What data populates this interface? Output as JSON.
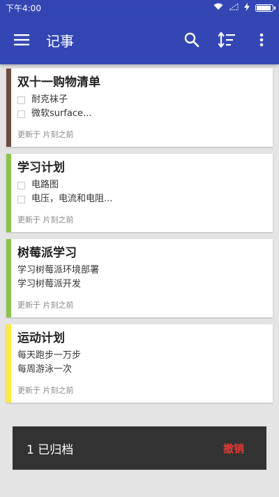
{
  "statusbar": {
    "time": "下午4:00",
    "battery_level": 0.9
  },
  "appbar": {
    "title": "记事"
  },
  "icons": {
    "menu": "hamburger-menu-icon",
    "search": "search-icon",
    "sort": "sort-icon",
    "more": "more-vert-icon"
  },
  "notes": [
    {
      "title": "双十一购物清单",
      "color": "#6d4c41",
      "lines": [
        "耐克袜子",
        "微软surface..."
      ],
      "updated": "更新于 片刻之前"
    },
    {
      "title": "学习计划",
      "color": "#8bc34a",
      "lines": [
        "电路图",
        "电压，电流和电阻..."
      ],
      "updated": "更新于 片刻之前"
    },
    {
      "title": "树莓派学习",
      "color": "#8bc34a",
      "lines": [
        "学习树莓派环境部署",
        "学习树莓派开发"
      ],
      "updated": "更新于 片刻之前"
    },
    {
      "title": "运动计划",
      "color": "#ffeb3b",
      "lines": [
        "每天跑步一万步",
        "每周游泳一次"
      ],
      "updated": "更新于 片刻之前"
    }
  ],
  "snackbar": {
    "message": "1 已归档",
    "action": "撤销",
    "action_color": "#e53935"
  }
}
